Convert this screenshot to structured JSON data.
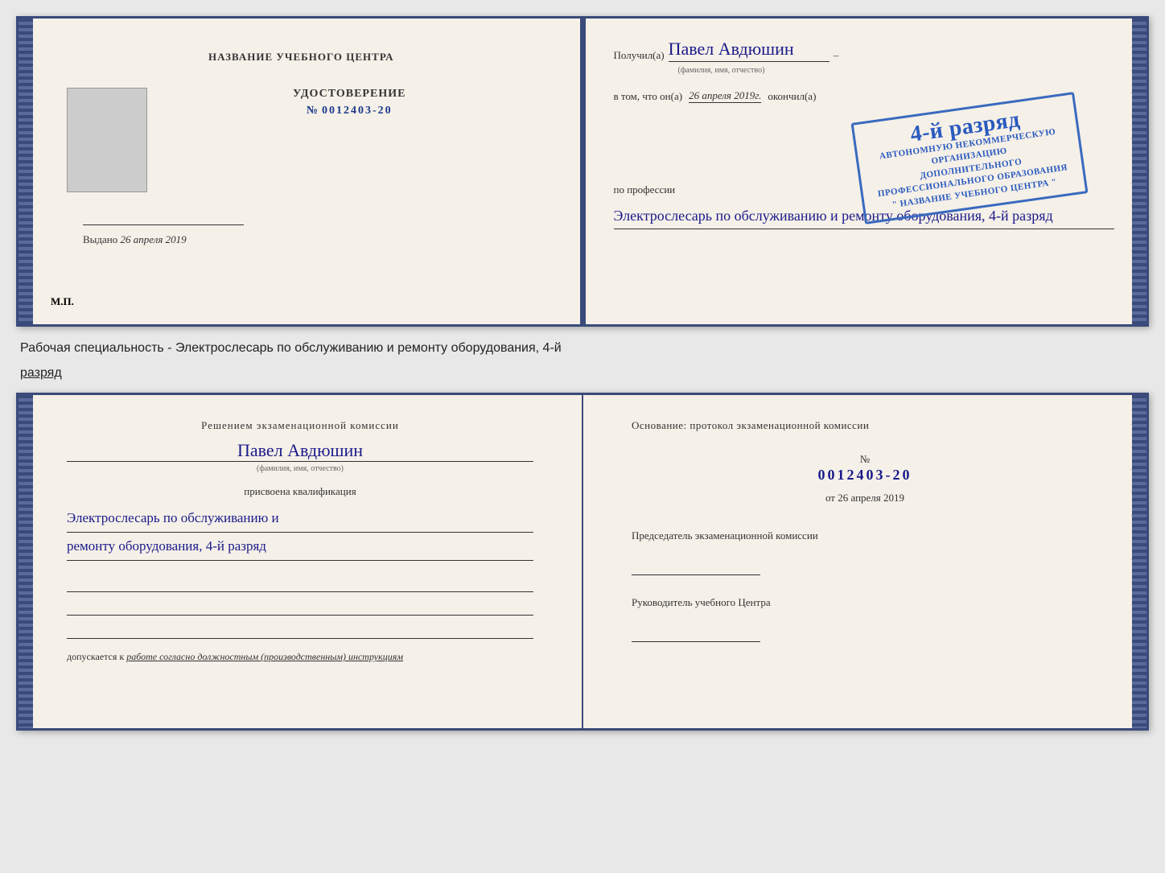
{
  "top_booklet": {
    "left": {
      "title": "НАЗВАНИЕ УЧЕБНОГО ЦЕНТРА",
      "udostoverenie": "УДОСТОВЕРЕНИЕ",
      "number_label": "№",
      "number": "0012403-20",
      "vydano_label": "Выдано",
      "vydano_date": "26 апреля 2019",
      "mp": "М.П."
    },
    "right": {
      "poluchil_label": "Получил(а)",
      "name": "Павел Авдюшин",
      "fio_sub": "(фамилия, имя, отчество)",
      "vtom_label": "в том, что он(а)",
      "date_hw": "26 апреля 2019г.",
      "okonchil_label": "окончил(а)",
      "stamp_line1": "АВТОНОМНУЮ НЕКОММЕРЧЕСКУЮ ОРГАНИЗАЦИЮ",
      "stamp_line2": "ДОПОЛНИТЕЛЬНОГО ПРОФЕССИОНАЛЬНОГО ОБРАЗОВАНИЯ",
      "stamp_line3": "\" НАЗВАНИЕ УЧЕБНОГО ЦЕНТРА \"",
      "stamp_number": "4-й разряд",
      "po_professii_label": "по профессии",
      "profession_line1": "Электрослесарь по обслуживанию и",
      "profession_line2": "ремонту оборудования, 4-й разряд"
    }
  },
  "between_label": "Рабочая специальность - Электрослесарь по обслуживанию и ремонту оборудования, 4-й",
  "between_label2": "разряд",
  "bottom_booklet": {
    "left": {
      "resheniyem": "Решением экзаменационной комиссии",
      "name": "Павел Авдюшин",
      "fio_sub": "(фамилия, имя, отчество)",
      "prisvoyena": "присвоена квалификация",
      "qual_line1": "Электрослесарь по обслуживанию и",
      "qual_line2": "ремонту оборудования, 4-й разряд",
      "dopuskaetsya_label": "допускается к",
      "dopuskaetsya_text": "работе согласно должностным (производственным) инструкциям"
    },
    "right": {
      "osnovanie": "Основание: протокол экзаменационной комиссии",
      "number_label": "№",
      "number": "0012403-20",
      "ot_label": "от",
      "ot_date": "26 апреля 2019",
      "predsedatel": "Председатель экзаменационной комиссии",
      "rukovoditel": "Руководитель учебного Центра"
    }
  },
  "dashes": [
    "-",
    "-",
    "-",
    "и",
    "а",
    "←",
    "-",
    "-",
    "-",
    "-"
  ],
  "accent_color": "#3a4a7a",
  "stamp_color": "#2a5abf",
  "hw_color": "#1a1a8a"
}
